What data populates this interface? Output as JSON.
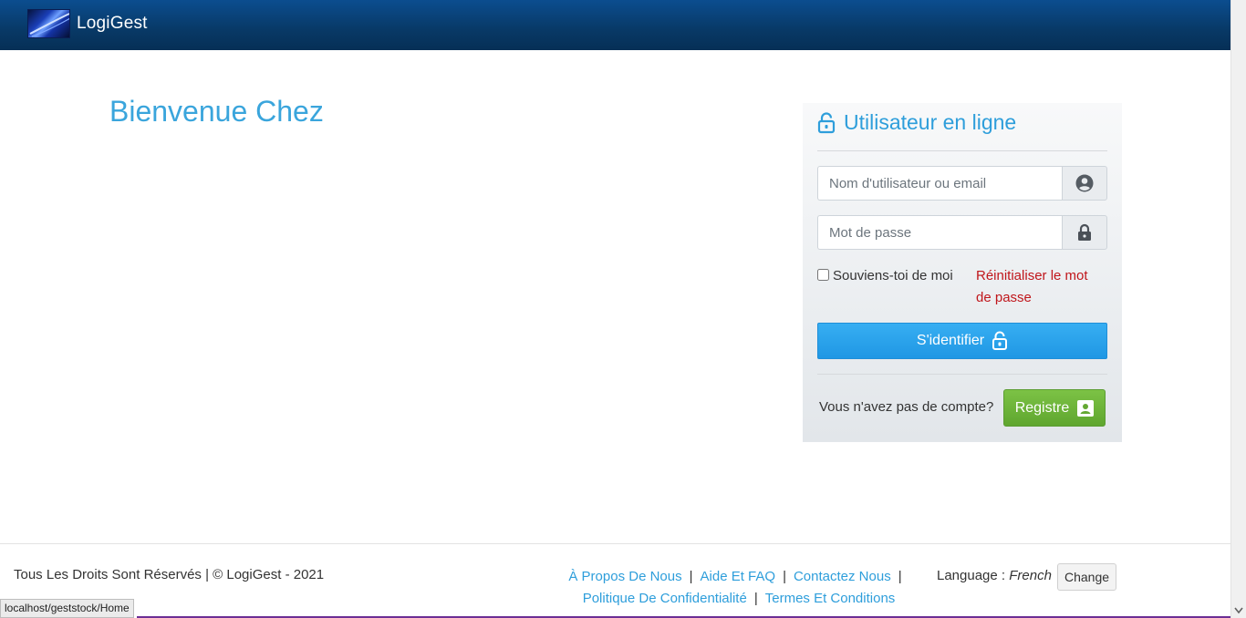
{
  "navbar": {
    "brand": "LogiGest",
    "logo_icon": "logigest-logo"
  },
  "main": {
    "welcome_title": "Bienvenue Chez"
  },
  "login": {
    "title": "Utilisateur en ligne",
    "username_placeholder": "Nom d'utilisateur ou email",
    "password_placeholder": "Mot de passe",
    "remember_label": "Souviens-toi de moi",
    "reset_link": "Réinitialiser le mot de passe",
    "signin_label": "S'identifier",
    "no_account_text": "Vous n'avez pas de compte?",
    "register_label": "Registre",
    "accent_color": "#2e9edb",
    "reset_color": "#c0161b",
    "register_color": "#6db33f"
  },
  "footer": {
    "copyright": "Tous Les Droits Sont Réservés | © LogiGest - 2021",
    "links": [
      "À Propos De Nous",
      "Aide Et FAQ",
      "Contactez Nous",
      "Politique De Confidentialité",
      "Termes Et Conditions"
    ],
    "language_label": "Language :",
    "language_value": "French",
    "change_label": "Change"
  },
  "status_bar": {
    "url": "localhost/geststock/Home"
  }
}
